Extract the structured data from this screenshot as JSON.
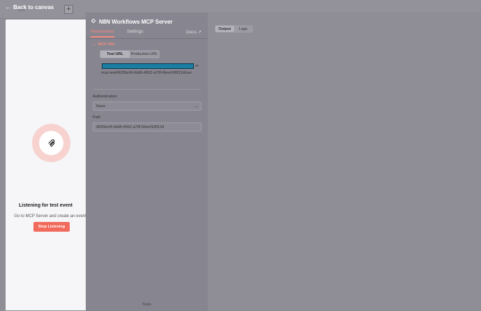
{
  "canvas": {
    "plus_label": "+",
    "label": "n8n"
  },
  "back": {
    "arrow": "←",
    "label": "Back to canvas"
  },
  "listening": {
    "title": "Listening for test event",
    "subtitle": "Go to MCP Server and create an event",
    "stop_label": "Stop Listening",
    "icon": "mcp-icon"
  },
  "node": {
    "title": "N8N Workflows MCP Server",
    "tabs": {
      "parameters": "Parameters",
      "settings": "Settings",
      "docs": "Docs ↗"
    },
    "section": {
      "chevron": "⌄",
      "label": "MCP URL"
    },
    "url_toggle": {
      "test": "Test URL",
      "production": "Production URL"
    },
    "url_text": "mcp-test/4625bcf4-0dd9-4562-a70f-6fee41f6f12d/sse",
    "url_prefix_suffix": "m",
    "authentication": {
      "label": "Authentication",
      "value": "None",
      "chevron": "⌄"
    },
    "path": {
      "label": "Path",
      "value": "4625bcf4-0dd9-4562-a70f-6fee41f6f12d"
    },
    "tools_label": "Tools"
  },
  "output": {
    "output_label": "Output",
    "logs_label": "Logs"
  },
  "colors": {
    "accent": "#f26a5b",
    "url_highlight": "#1a7da3"
  }
}
